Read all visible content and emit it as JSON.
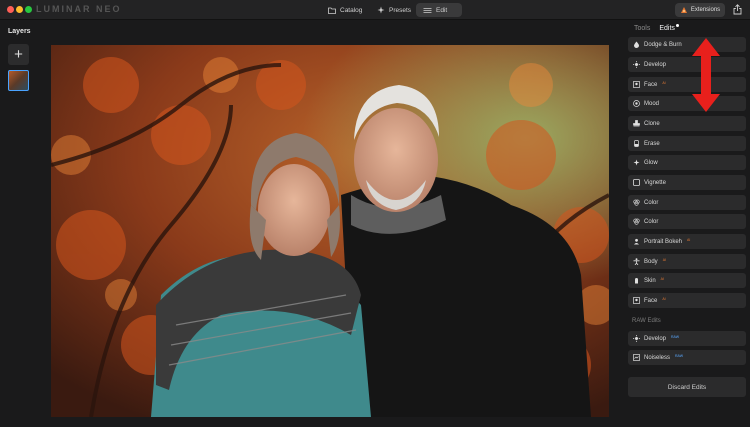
{
  "app": {
    "logo_text": "LUMINAR NEO"
  },
  "topbar": {
    "catalog_label": "Catalog",
    "presets_label": "Presets",
    "edit_label": "Edit",
    "extensions_label": "Extensions"
  },
  "layers": {
    "title": "Layers",
    "add_symbol": "+"
  },
  "panel": {
    "tools_tab": "Tools",
    "edits_tab": "Edits",
    "edits": [
      {
        "label": "Dodge & Burn",
        "badge": ""
      },
      {
        "label": "Develop",
        "badge": ""
      },
      {
        "label": "Face",
        "badge": "AI"
      },
      {
        "label": "Mood",
        "badge": ""
      },
      {
        "label": "Clone",
        "badge": ""
      },
      {
        "label": "Erase",
        "badge": ""
      },
      {
        "label": "Glow",
        "badge": ""
      },
      {
        "label": "Vignette",
        "badge": ""
      },
      {
        "label": "Color",
        "badge": ""
      },
      {
        "label": "Color",
        "badge": ""
      },
      {
        "label": "Portrait Bokeh",
        "badge": "AI"
      },
      {
        "label": "Body",
        "badge": "AI"
      },
      {
        "label": "Skin",
        "badge": "AI"
      },
      {
        "label": "Face",
        "badge": "AI"
      }
    ],
    "raw_title": "RAW Edits",
    "raw_edits": [
      {
        "label": "Develop",
        "badge": "RAW"
      },
      {
        "label": "Noiseless",
        "badge": "RAW"
      }
    ],
    "discard_label": "Discard Edits"
  },
  "colors": {
    "background": "#1a1a1b",
    "panel_item": "#2b2b2c",
    "annotation_arrow": "#e8201c",
    "ai_badge": "#e57a35",
    "raw_badge": "#5aa9ff",
    "selection": "#4aa3ff"
  }
}
